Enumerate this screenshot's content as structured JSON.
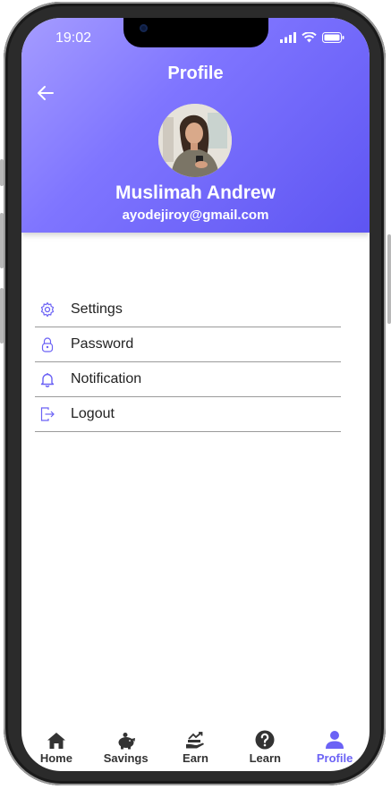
{
  "status_bar": {
    "time": "19:02"
  },
  "header": {
    "title": "Profile",
    "name": "Muslimah Andrew",
    "email": "ayodejiroy@gmail.com"
  },
  "menu": {
    "items": [
      {
        "label": "Settings",
        "icon": "gear-icon"
      },
      {
        "label": "Password",
        "icon": "lock-icon"
      },
      {
        "label": "Notification",
        "icon": "bell-icon"
      },
      {
        "label": "Logout",
        "icon": "logout-icon"
      }
    ]
  },
  "bottom_nav": {
    "items": [
      {
        "label": "Home",
        "icon": "home-icon"
      },
      {
        "label": "Savings",
        "icon": "piggy-bank-icon"
      },
      {
        "label": "Earn",
        "icon": "earn-icon"
      },
      {
        "label": "Learn",
        "icon": "question-icon"
      },
      {
        "label": "Profile",
        "icon": "person-icon"
      }
    ],
    "active": "Profile"
  },
  "colors": {
    "accent": "#6b62f5",
    "header_gradient_start": "#a59cff",
    "header_gradient_end": "#5e55f2"
  }
}
